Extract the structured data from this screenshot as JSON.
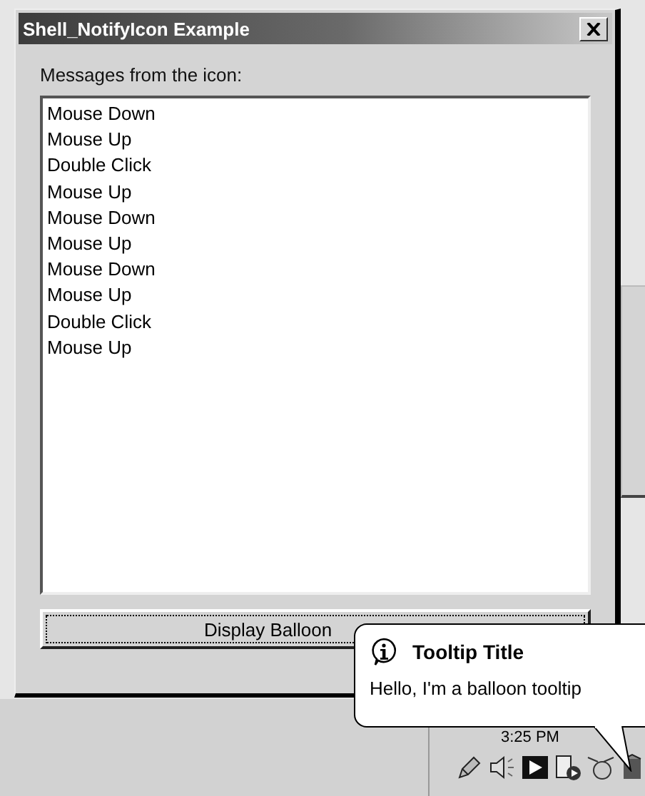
{
  "window": {
    "title": "Shell_NotifyIcon Example",
    "label": "Messages from the icon:",
    "messages": [
      "Mouse Down",
      "Mouse Up",
      "Double Click",
      "Mouse Up",
      "Mouse Down",
      "Mouse Up",
      "Mouse Down",
      "Mouse Up",
      "Double Click",
      "Mouse Up"
    ],
    "button": "Display Balloon"
  },
  "balloon": {
    "title": "Tooltip Title",
    "text": "Hello, I'm a balloon tooltip"
  },
  "tray": {
    "clock": "3:25 PM"
  }
}
